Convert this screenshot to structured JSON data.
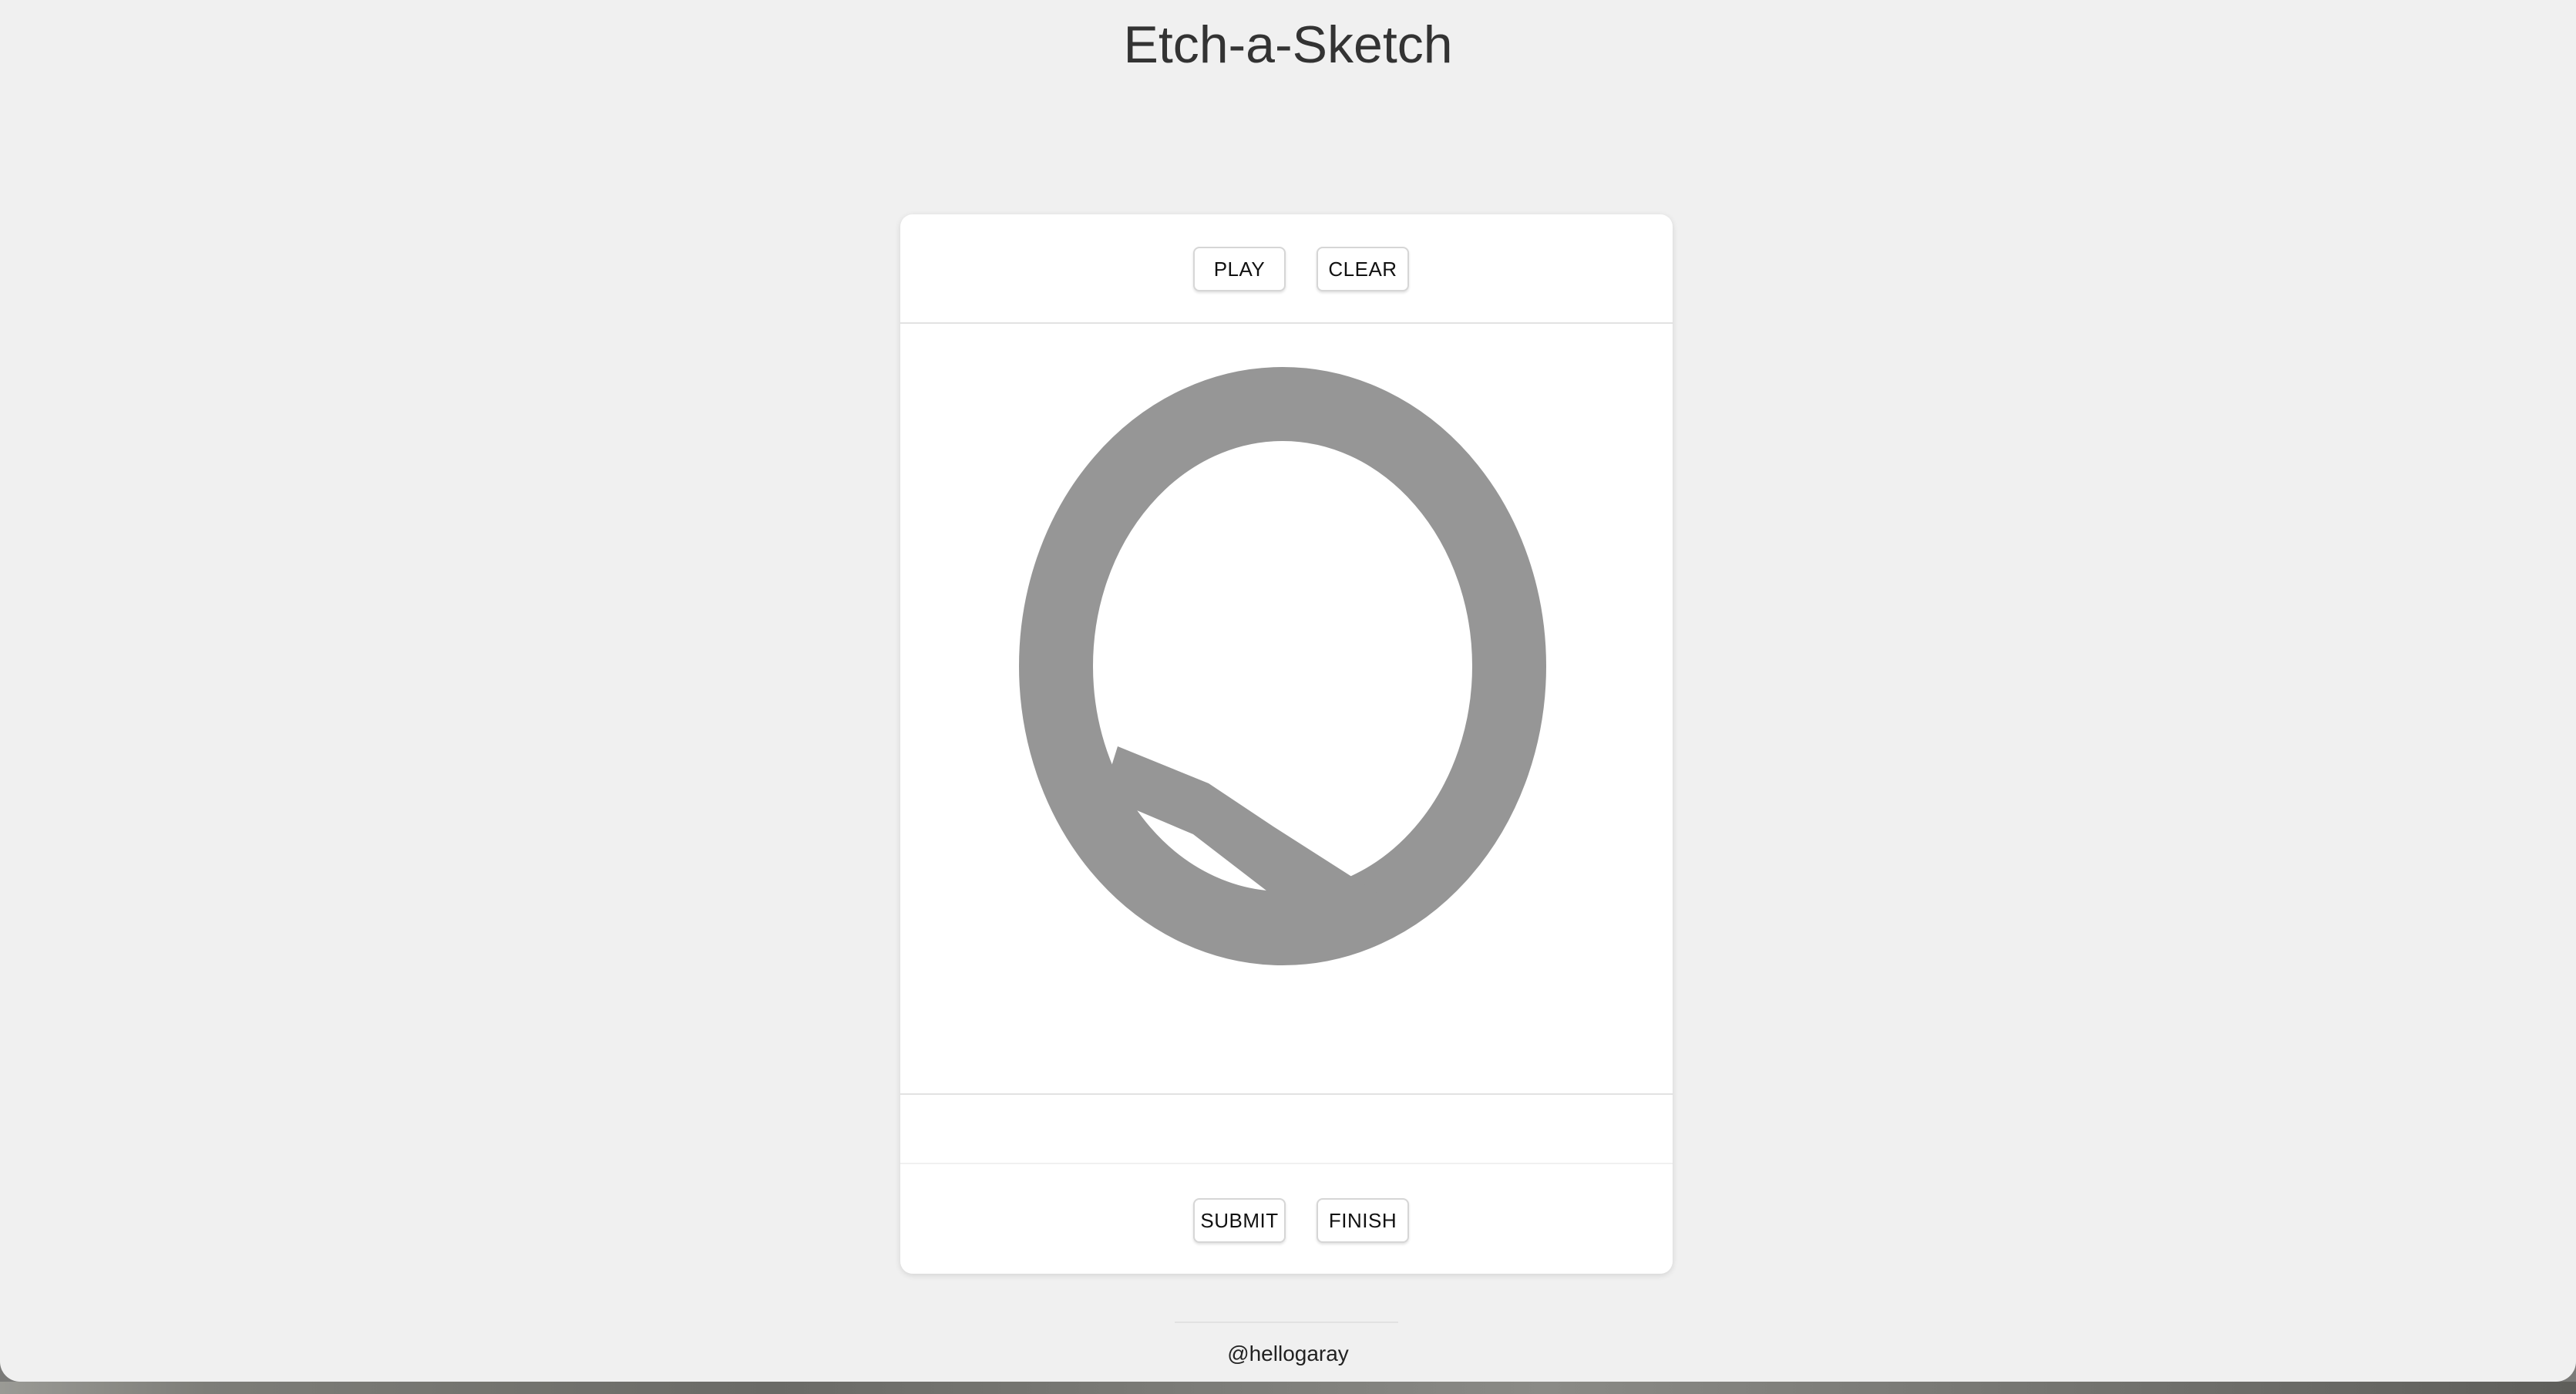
{
  "page": {
    "title": "Etch-a-Sketch",
    "credit": "@hellogaray"
  },
  "toolbar": {
    "play_label": "PLAY",
    "clear_label": "CLEAR"
  },
  "sketch": {
    "letter": "Q",
    "color": "#969696"
  },
  "status": {
    "message": ""
  },
  "actions": {
    "submit_label": "SUBMIT",
    "finish_label": "FINISH"
  },
  "colors": {
    "background": "#f0f0f0",
    "card": "#ffffff",
    "title_text": "#333333",
    "divider": "#e2e2e2"
  }
}
